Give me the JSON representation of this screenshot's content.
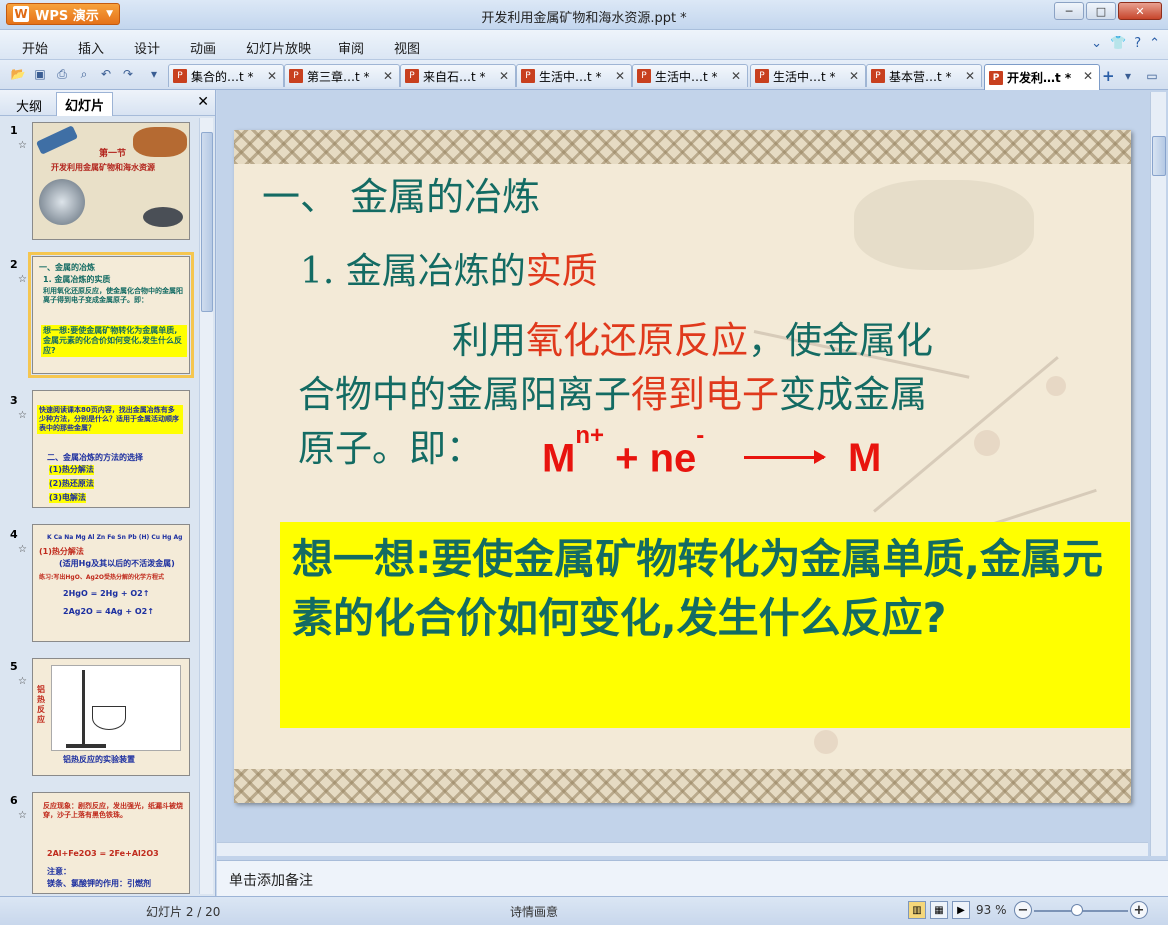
{
  "window": {
    "app_button": "WPS 演示",
    "title": "开发利用金属矿物和海水资源.ppt *"
  },
  "menu": [
    "开始",
    "插入",
    "设计",
    "动画",
    "幻灯片放映",
    "审阅",
    "视图"
  ],
  "tabs": [
    {
      "label": "集合的…t *"
    },
    {
      "label": "第三章…t *"
    },
    {
      "label": "来自石…t *"
    },
    {
      "label": "生活中…t *"
    },
    {
      "label": "生活中…t *"
    },
    {
      "label": "生活中…t *"
    },
    {
      "label": "基本营…t *"
    },
    {
      "label": "开发利…t *",
      "active": true
    }
  ],
  "left_panel": {
    "tab_outline": "大纲",
    "tab_slides": "幻灯片",
    "slides": [
      {
        "num": "1",
        "texts": [
          "第一节",
          "开发利用金属矿物和海水资源"
        ]
      },
      {
        "num": "2",
        "texts": [
          "一、金属的冶炼",
          "1. 金属冶炼的实质",
          "利用氧化还原反应，使金属化合物中的金属阳离子得到电子变成金属原子。即：",
          "想一想:要使金属矿物转化为金属单质,金属元素的化合价如何变化,发生什么反应?"
        ]
      },
      {
        "num": "3",
        "texts": [
          "快速阅读课本80页内容，找出金属冶炼有多少种方法，分别是什么？适用于金属活动顺序表中的那些金属？",
          "二、金属冶炼的方法的选择",
          "(1)热分解法",
          "(2)热还原法",
          "(3)电解法"
        ]
      },
      {
        "num": "4",
        "texts": [
          "K Ca Na Mg Al Zn Fe Sn Pb (H) Cu Hg Ag",
          "(1)热分解法",
          "(适用Hg及其以后的不活泼金属)",
          "练习:写出HgO、Ag2O受热分解的化学方程式",
          "2HgO = 2Hg + O2↑",
          "2Ag2O = 4Ag + O2↑"
        ]
      },
      {
        "num": "5",
        "texts": [
          "铝热反应",
          "铝热反应的实验装置"
        ]
      },
      {
        "num": "6",
        "texts": [
          "反应现象：剧烈反应，发出强光，纸漏斗被烧穿，沙子上落有黑色铁珠。",
          "2Al+Fe2O3 = 2Fe+Al2O3",
          "注意：",
          "镁条、氯酸钾的作用：引燃剂"
        ]
      }
    ]
  },
  "slide": {
    "heading1": "一、 金属的冶炼",
    "heading2_prefix": "1. 金属冶炼的",
    "heading2_highlight": "实质",
    "body_p1_a": "利用",
    "body_p1_b": "氧化还原反应",
    "body_p1_c": "，使金属化",
    "body_p2_a": "合物中的金属阳离子",
    "body_p2_b": "得到电子",
    "body_p2_c": "变成金属",
    "body_p3": "原子。即：",
    "equation": {
      "reactant": "M",
      "charge": "n+",
      "plus": "+ ne",
      "electron": "-",
      "product": "M"
    },
    "think": "想一想:要使金属矿物转化为金属单质,金属元素的化合价如何变化,发生什么反应?"
  },
  "notes_placeholder": "单击添加备注",
  "status": {
    "slide_counter": "幻灯片 2 / 20",
    "theme": "诗情画意",
    "zoom": "93 %"
  }
}
